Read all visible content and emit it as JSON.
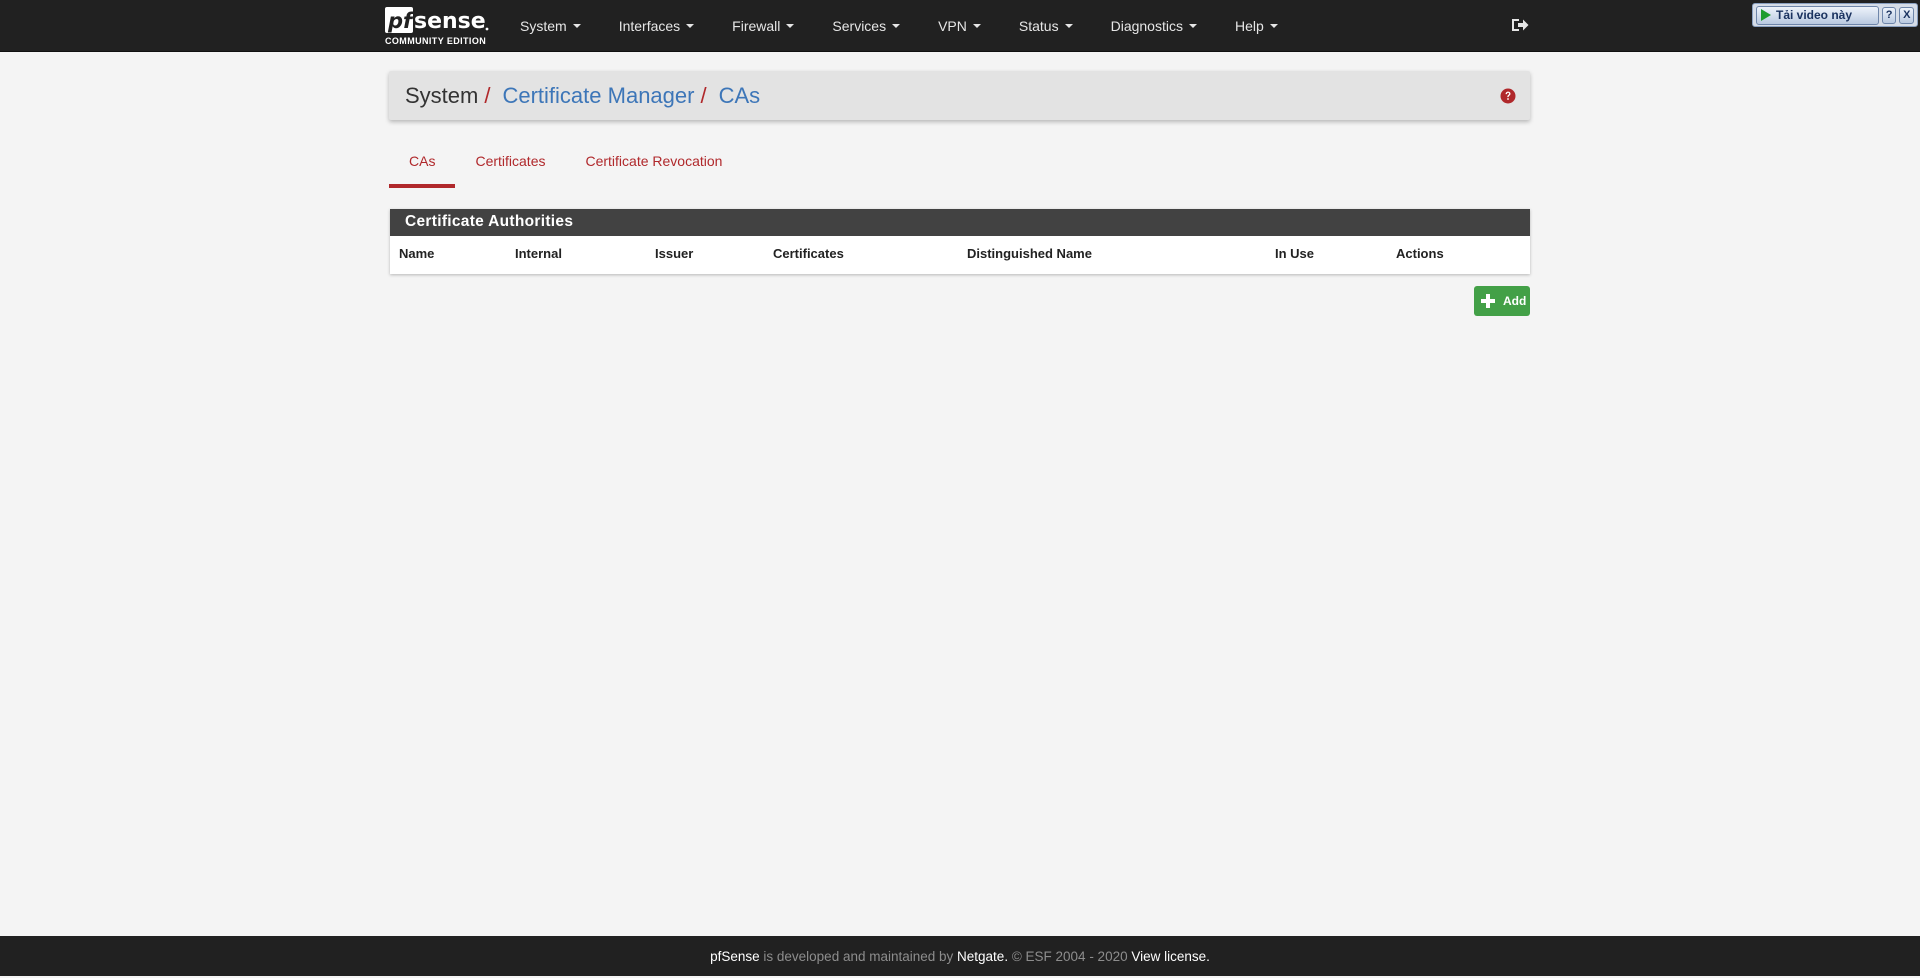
{
  "brand": {
    "logo_text": "pfsense",
    "edition": "COMMUNITY EDITION"
  },
  "nav": {
    "items": [
      {
        "label": "System"
      },
      {
        "label": "Interfaces"
      },
      {
        "label": "Firewall"
      },
      {
        "label": "Services"
      },
      {
        "label": "VPN"
      },
      {
        "label": "Status"
      },
      {
        "label": "Diagnostics"
      },
      {
        "label": "Help"
      }
    ],
    "logout_icon": "sign-out-icon"
  },
  "overlay_widget": {
    "download_label": "Tải video này",
    "help_label": "?",
    "close_label": "X"
  },
  "breadcrumb": {
    "root": "System",
    "sep1": "/",
    "middle": "Certificate Manager",
    "sep2": "/",
    "current": "CAs",
    "help_icon": "question-circle-icon"
  },
  "tabs": [
    {
      "label": "CAs",
      "active": true
    },
    {
      "label": "Certificates",
      "active": false
    },
    {
      "label": "Certificate Revocation",
      "active": false
    }
  ],
  "panel": {
    "title": "Certificate Authorities",
    "columns": [
      "Name",
      "Internal",
      "Issuer",
      "Certificates",
      "Distinguished Name",
      "In Use",
      "Actions"
    ],
    "rows": []
  },
  "add_button": {
    "label": "Add",
    "icon": "plus-icon"
  },
  "footer": {
    "brand": "pfSense",
    "text1": " is developed and maintained by ",
    "company": "Netgate.",
    "text2": " © ESF 2004 - 2020 ",
    "license": "View license."
  },
  "colors": {
    "navbar": "#212121",
    "accent_red": "#b0282b",
    "link_blue": "#3d76b8",
    "panel_head": "#424242",
    "add_green": "#43a047"
  }
}
